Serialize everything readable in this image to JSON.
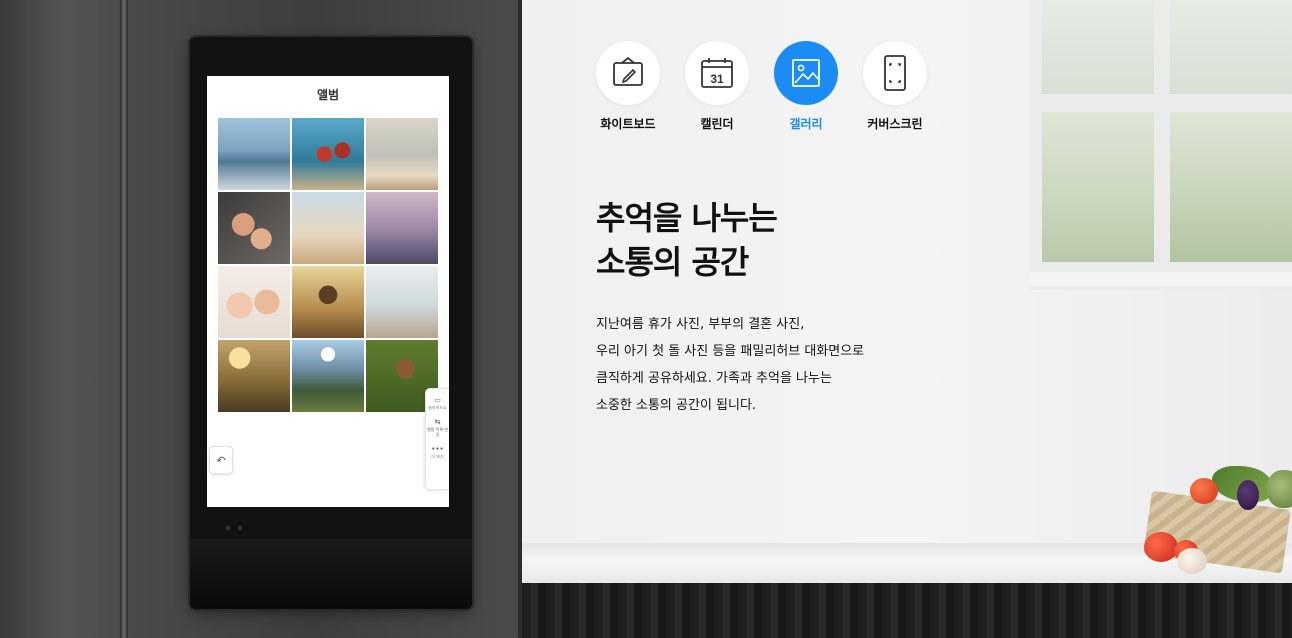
{
  "album_screen": {
    "title": "앨범",
    "photos": [
      "beach-sea",
      "couple-splash",
      "tropical-beach",
      "father-kids",
      "family-beach",
      "couple-sunset",
      "babies",
      "father-child-field",
      "beach-walk",
      "child-field-sunset",
      "mountain-hikers",
      "dog-grass"
    ],
    "side_menu": [
      {
        "icon": "slideshow-icon",
        "label": "슬라이드쇼"
      },
      {
        "icon": "album-list-icon",
        "label": "앨범 목록 변경"
      },
      {
        "icon": "more-icon",
        "label": "더 보기"
      }
    ]
  },
  "categories": [
    {
      "id": "whiteboard",
      "label": "화이트보드",
      "icon": "whiteboard-icon",
      "active": false
    },
    {
      "id": "calendar",
      "label": "캘린더",
      "icon": "calendar-icon",
      "calendar_day": "31",
      "active": false
    },
    {
      "id": "gallery",
      "label": "갤러리",
      "icon": "gallery-icon",
      "active": true
    },
    {
      "id": "coverscreen",
      "label": "커버스크린",
      "icon": "cover-screen-icon",
      "active": false
    }
  ],
  "headline": {
    "line1": "추억을 나누는",
    "line2": "소통의 공간"
  },
  "description": {
    "line1": "지난여름 휴가 사진, 부부의 결혼 사진,",
    "line2": "우리 아기 첫 돌 사진 등을 패밀리허브 대화면으로",
    "line3": "큼직하게 공유하세요. 가족과 추억을 나누는",
    "line4": "소중한 소통의 공간이 됩니다."
  },
  "colors": {
    "accent": "#1c8cf5",
    "text": "#111111",
    "fridge": "#4a4a4d"
  }
}
